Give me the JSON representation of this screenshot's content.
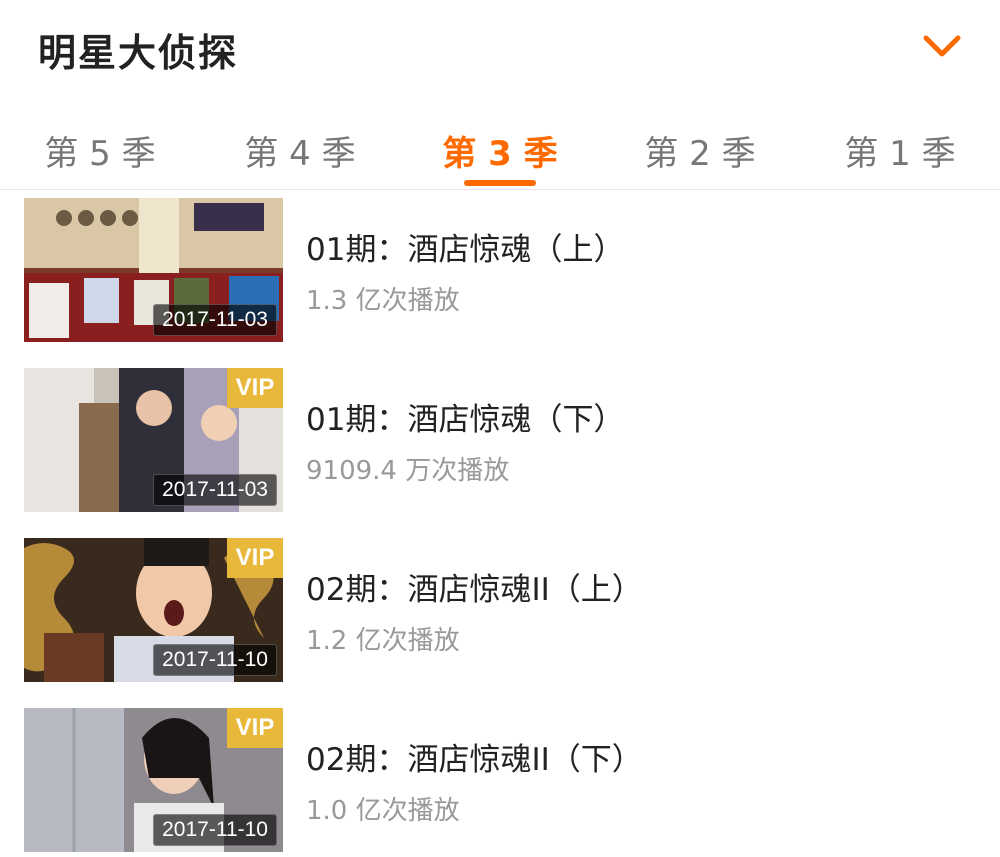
{
  "header": {
    "title": "明星大侦探",
    "expand_icon": "chevron-down-icon",
    "accent": "#ff6a00"
  },
  "tabs": [
    {
      "label": "第 5 季",
      "active": false
    },
    {
      "label": "第 4 季",
      "active": false
    },
    {
      "label": "第 3 季",
      "active": true
    },
    {
      "label": "第 2 季",
      "active": false
    },
    {
      "label": "第 1 季",
      "active": false
    }
  ],
  "episodes": [
    {
      "title": "01期：酒店惊魂（上）",
      "plays": "1.3 亿次播放",
      "date": "2017-11-03",
      "vip": ""
    },
    {
      "title": "01期：酒店惊魂（下）",
      "plays": "9109.4 万次播放",
      "date": "2017-11-03",
      "vip": "VIP"
    },
    {
      "title": "02期：酒店惊魂II（上）",
      "plays": "1.2 亿次播放",
      "date": "2017-11-10",
      "vip": "VIP"
    },
    {
      "title": "02期：酒店惊魂II（下）",
      "plays": "1.0 亿次播放",
      "date": "2017-11-10",
      "vip": "VIP"
    }
  ],
  "colors": {
    "vip_badge": "#e8b83a",
    "secondary_text": "#999999"
  }
}
